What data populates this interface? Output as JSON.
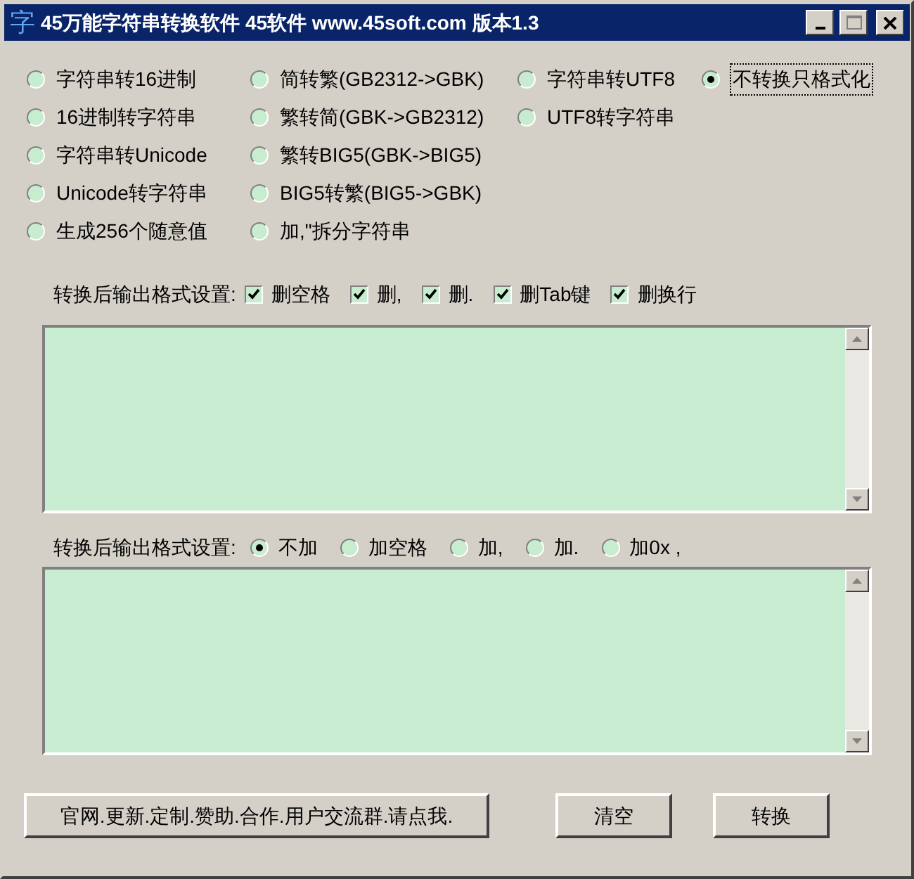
{
  "window": {
    "icon_char": "字",
    "title": "45万能字符串转换软件 45软件 www.45soft.com 版本1.3"
  },
  "conversion_columns": [
    {
      "options": [
        {
          "label": "字符串转16进制",
          "selected": false
        },
        {
          "label": "16进制转字符串",
          "selected": false
        },
        {
          "label": "字符串转Unicode",
          "selected": false
        },
        {
          "label": "Unicode转字符串",
          "selected": false
        },
        {
          "label": "生成256个随意值",
          "selected": false
        }
      ]
    },
    {
      "options": [
        {
          "label": "简转繁(GB2312->GBK)",
          "selected": false
        },
        {
          "label": "繁转简(GBK->GB2312)",
          "selected": false
        },
        {
          "label": "繁转BIG5(GBK->BIG5)",
          "selected": false
        },
        {
          "label": "BIG5转繁(BIG5->GBK)",
          "selected": false
        },
        {
          "label": "加,\"拆分字符串",
          "selected": false
        }
      ]
    },
    {
      "options": [
        {
          "label": "字符串转UTF8",
          "selected": false
        },
        {
          "label": "UTF8转字符串",
          "selected": false
        }
      ]
    },
    {
      "options": [
        {
          "label": "不转换只格式化",
          "selected": true
        }
      ]
    }
  ],
  "delete_settings": {
    "label": "转换后输出格式设置:",
    "options": [
      {
        "label": "删空格",
        "checked": true
      },
      {
        "label": "删,",
        "checked": true
      },
      {
        "label": "删.",
        "checked": true
      },
      {
        "label": "删Tab键",
        "checked": true
      },
      {
        "label": "删换行",
        "checked": true
      }
    ]
  },
  "add_settings": {
    "label": "转换后输出格式设置:",
    "options": [
      {
        "label": "不加",
        "selected": true
      },
      {
        "label": "加空格",
        "selected": false
      },
      {
        "label": "加,",
        "selected": false
      },
      {
        "label": "加.",
        "selected": false
      },
      {
        "label": "加0x ,",
        "selected": false
      }
    ]
  },
  "buttons": [
    {
      "label": "官网.更新.定制.赞助.合作.用户交流群.请点我."
    },
    {
      "label": "清空"
    },
    {
      "label": "转换"
    }
  ]
}
